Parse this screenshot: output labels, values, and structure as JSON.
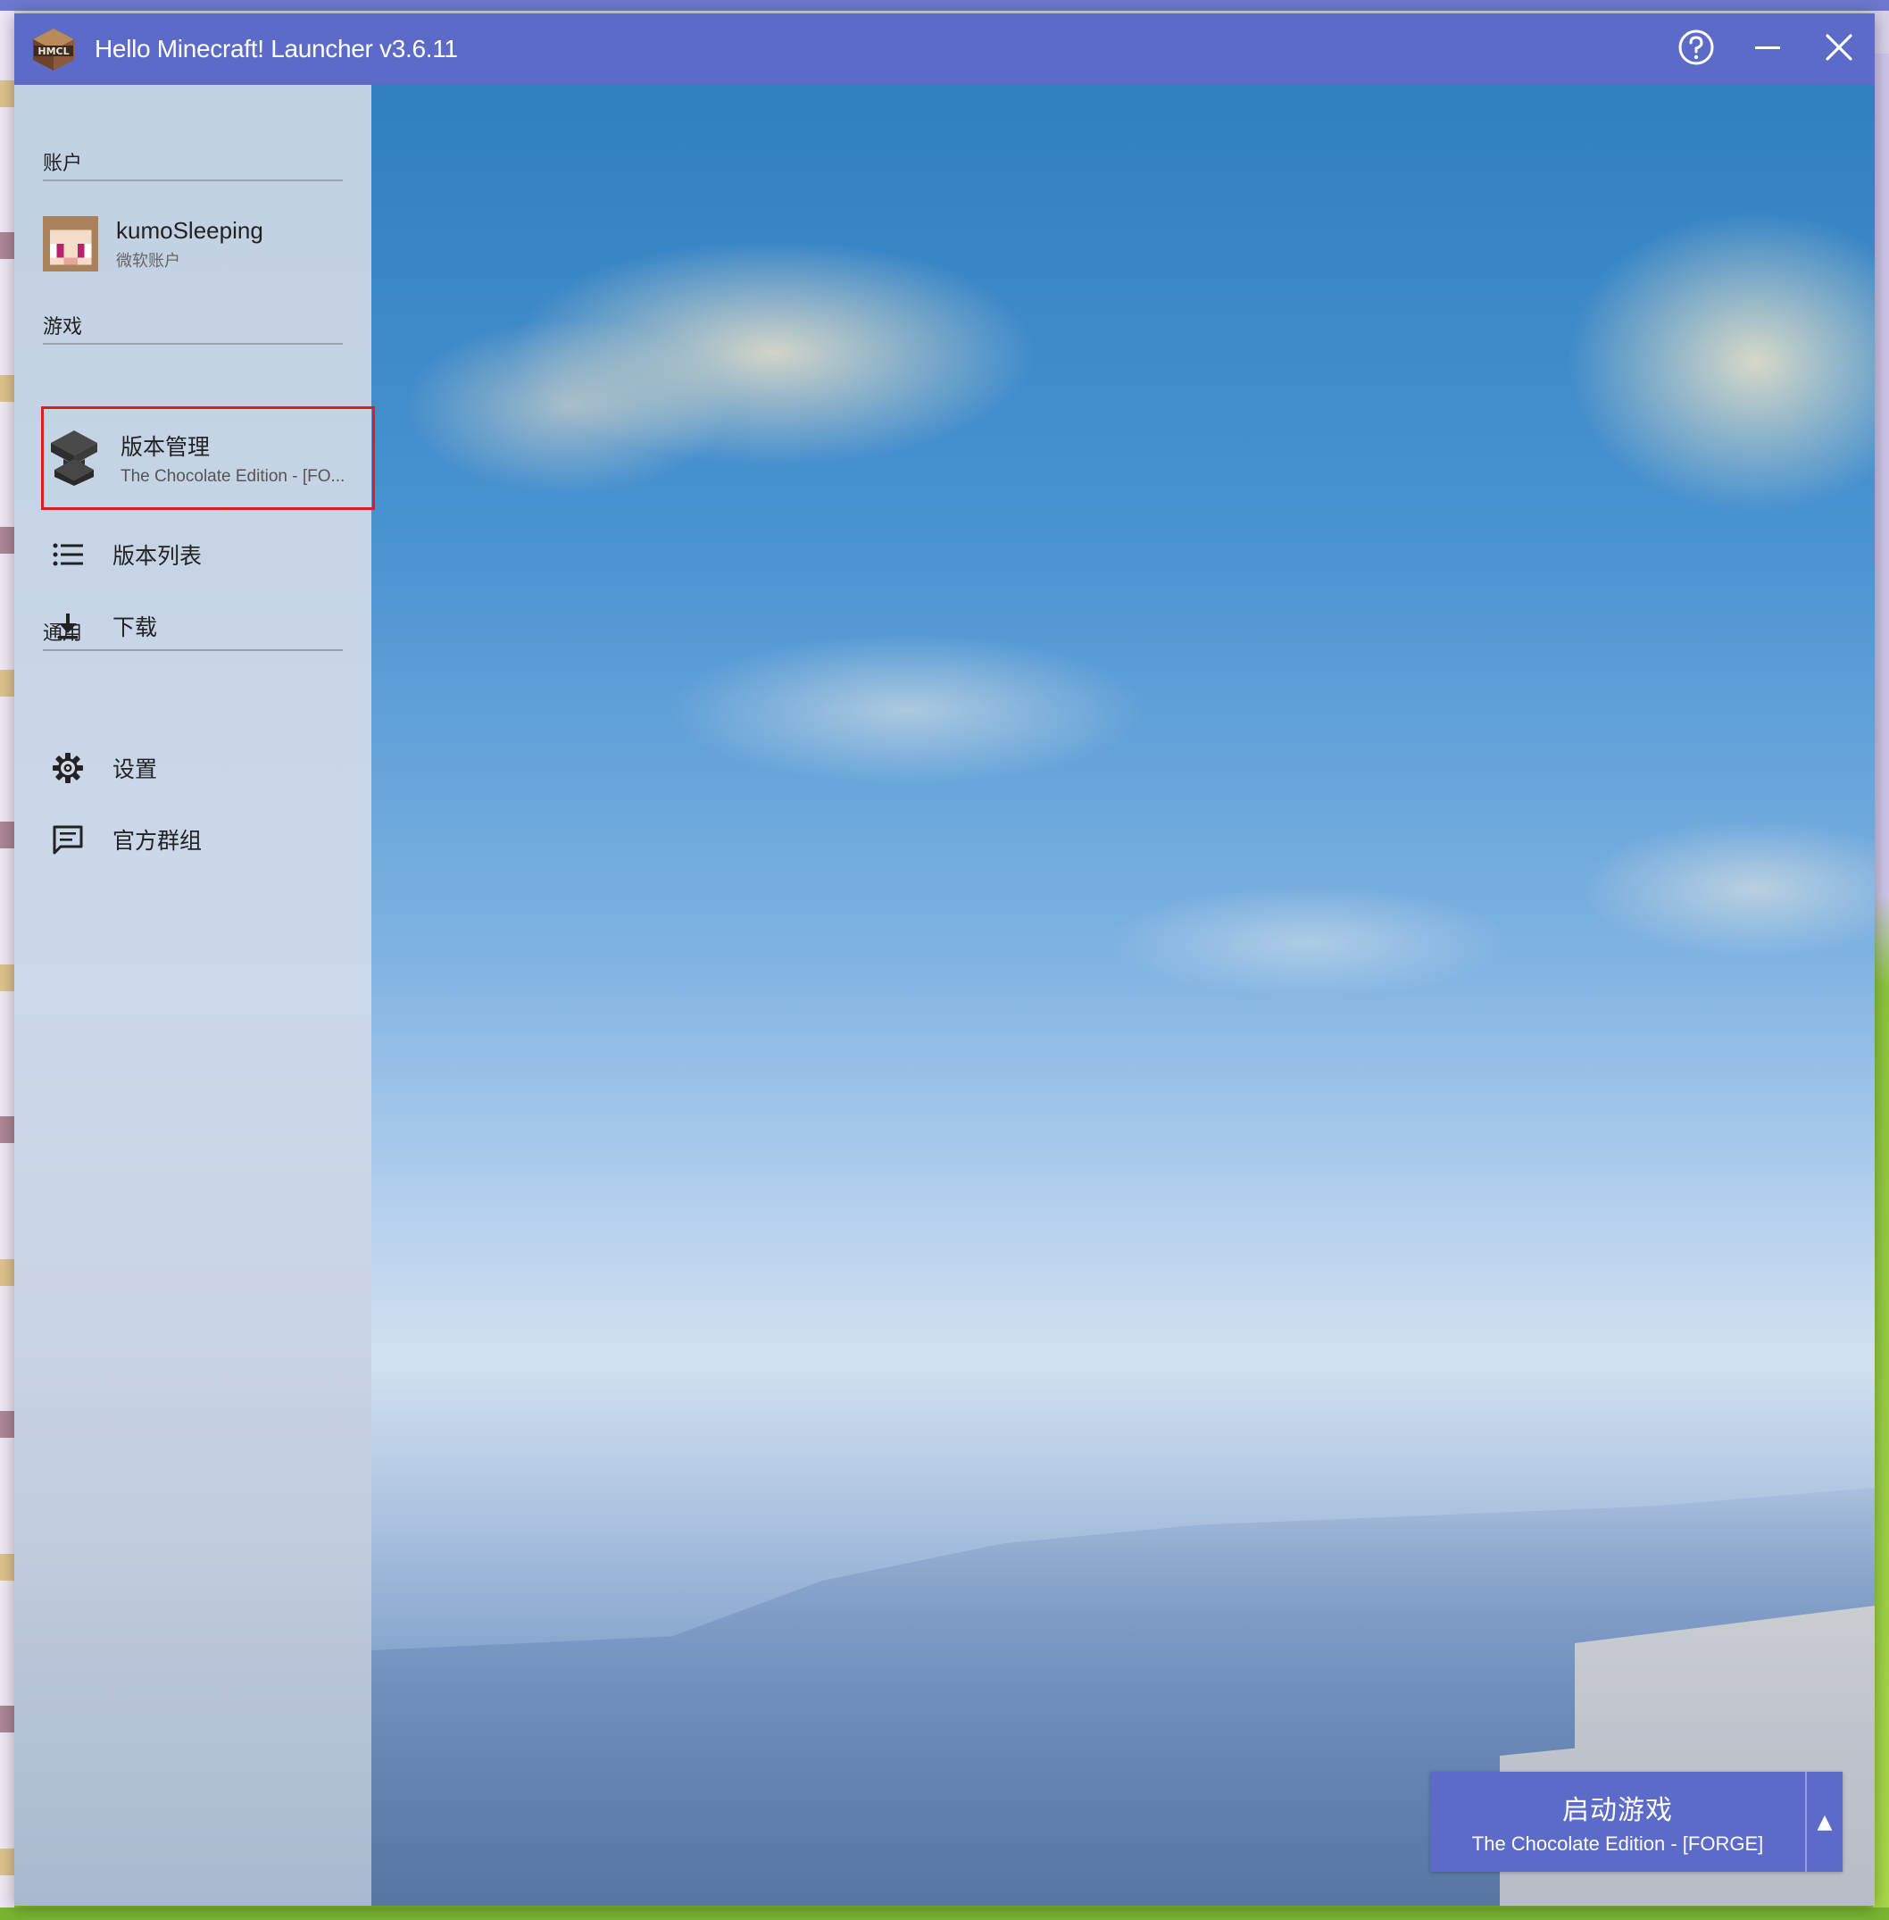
{
  "window": {
    "title": "Hello Minecraft! Launcher v3.6.11"
  },
  "sidebar": {
    "account_section": "账户",
    "account": {
      "name": "kumoSleeping",
      "type": "微软账户"
    },
    "game_section": "游戏",
    "version_item": {
      "title": "版本管理",
      "subtitle": "The Chocolate Edition - [FO..."
    },
    "version_list": "版本列表",
    "download": "下载",
    "general_section": "通用",
    "settings": "设置",
    "official_group": "官方群组"
  },
  "launch": {
    "title": "启动游戏",
    "subtitle": "The Chocolate Edition - [FORGE]",
    "arrow": "▲"
  },
  "colors": {
    "accent": "#5c6bc8",
    "highlight_border": "#e21b1b"
  },
  "icons": [
    "hmcl-logo-icon",
    "help-icon",
    "minimize-icon",
    "close-icon",
    "avatar",
    "anvil-icon",
    "list-icon",
    "download-icon",
    "gear-icon",
    "chat-icon"
  ]
}
